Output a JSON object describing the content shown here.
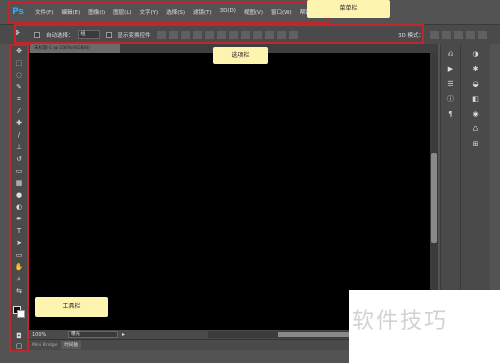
{
  "app": {
    "logo": "Ps"
  },
  "menubar": {
    "items": [
      "文件(F)",
      "编辑(E)",
      "图像(I)",
      "图层(L)",
      "文字(Y)",
      "选择(S)",
      "滤镜(T)",
      "3D(D)",
      "视图(V)",
      "窗口(W)",
      "帮助(H)"
    ]
  },
  "options": {
    "tool_icon": "move-tool-icon",
    "auto_select_label": "自动选择：",
    "auto_select_value": "组",
    "show_transform_label": "显示变换控件",
    "mode_label": "3D 模式："
  },
  "document": {
    "tab_label": "未标题-1 @ 100%(RGB/8)"
  },
  "statusbar": {
    "zoom": "100%",
    "status_text": "曝光"
  },
  "bridge": {
    "tabs": [
      "Mini Bridge",
      "时间轴"
    ]
  },
  "annotations": {
    "menubar_label": "菜单栏",
    "options_label": "选项栏",
    "toolbar_label": "工具栏",
    "color": "#c0272d"
  },
  "watermark": {
    "text": "软件技巧"
  }
}
